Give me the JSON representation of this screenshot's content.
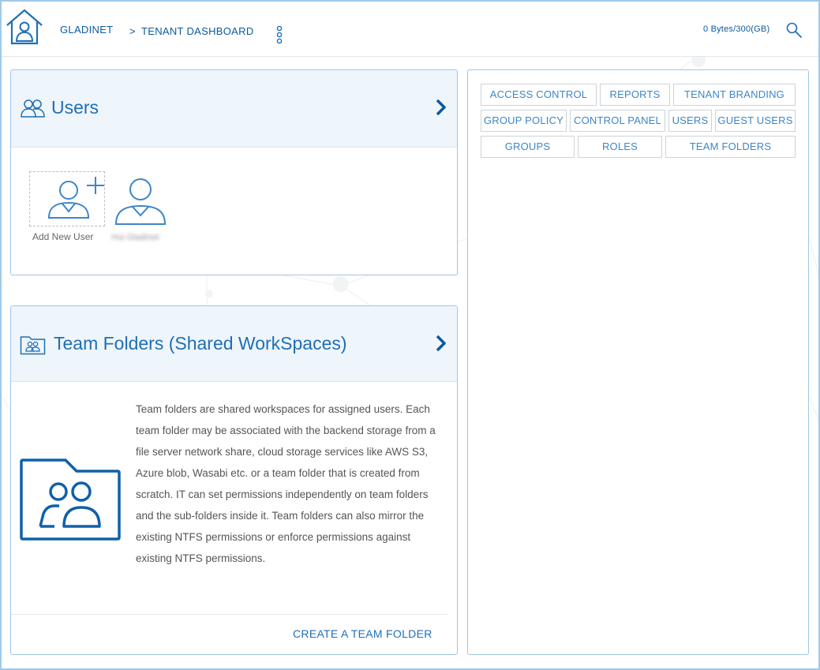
{
  "header": {
    "root_label": "GLADINET",
    "separator": ">",
    "current_label": "TENANT DASHBOARD",
    "quota": "0 Bytes/300(GB)"
  },
  "users_panel": {
    "title": "Users",
    "add_user_label": "Add New User",
    "user_name": "Hui Gladinet"
  },
  "team_folders_panel": {
    "title": "Team Folders (Shared WorkSpaces)",
    "description": "Team folders are shared workspaces for assigned users. Each team folder may be associated with the backend storage from a file server network share, cloud storage services like AWS S3, Azure blob, Wasabi etc. or a team folder that is created from scratch. IT can set permissions independently on team folders and the sub-folders inside it. Team folders can also mirror the existing NTFS permissions or enforce permissions against existing NTFS permissions.",
    "create_label": "CREATE A TEAM FOLDER"
  },
  "admin_tabs": [
    {
      "label": "ACCESS CONTROL"
    },
    {
      "label": "REPORTS"
    },
    {
      "label": "TENANT BRANDING"
    },
    {
      "label": "GROUP POLICY"
    },
    {
      "label": "CONTROL PANEL"
    },
    {
      "label": "USERS"
    },
    {
      "label": "GUEST USERS"
    },
    {
      "label": "GROUPS"
    },
    {
      "label": "ROLES"
    },
    {
      "label": "TEAM FOLDERS"
    }
  ],
  "colors": {
    "accent": "#1f6fb4",
    "dark_blue": "#0b5a9e",
    "panel_header": "#eef5fb",
    "panel_border": "#9fc7e6"
  }
}
